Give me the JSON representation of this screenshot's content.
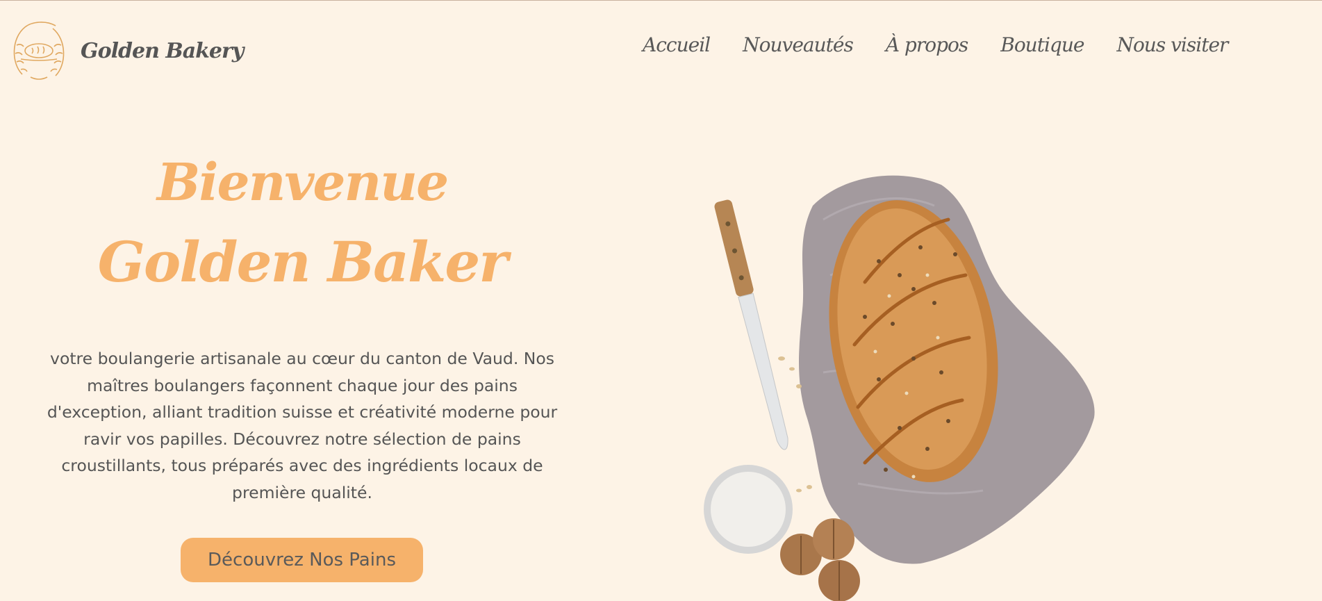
{
  "header": {
    "brand": "Golden Bakery",
    "logo_icon": "bread-wreath-logo"
  },
  "nav": {
    "items": [
      {
        "label": "Accueil"
      },
      {
        "label": "Nouveautés"
      },
      {
        "label": "À propos"
      },
      {
        "label": "Boutique"
      },
      {
        "label": "Nous visiter"
      }
    ]
  },
  "hero": {
    "title_line1": "Bienvenue",
    "title_line2": "Golden Baker",
    "description": "votre boulangerie artisanale au cœur du canton de Vaud. Nos maîtres boulangers façonnent chaque jour des pains d'exception, alliant tradition suisse et créativité moderne pour ravir vos papilles. Découvrez notre sélection de pains croustillants, tous préparés avec des ingrédients locaux de première qualité.",
    "cta_label": "Découvrez Nos Pains",
    "image_icon": "bread-loaf-illustration"
  },
  "colors": {
    "background": "#fdf3e6",
    "accent": "#f6b26b",
    "text": "#585858"
  }
}
